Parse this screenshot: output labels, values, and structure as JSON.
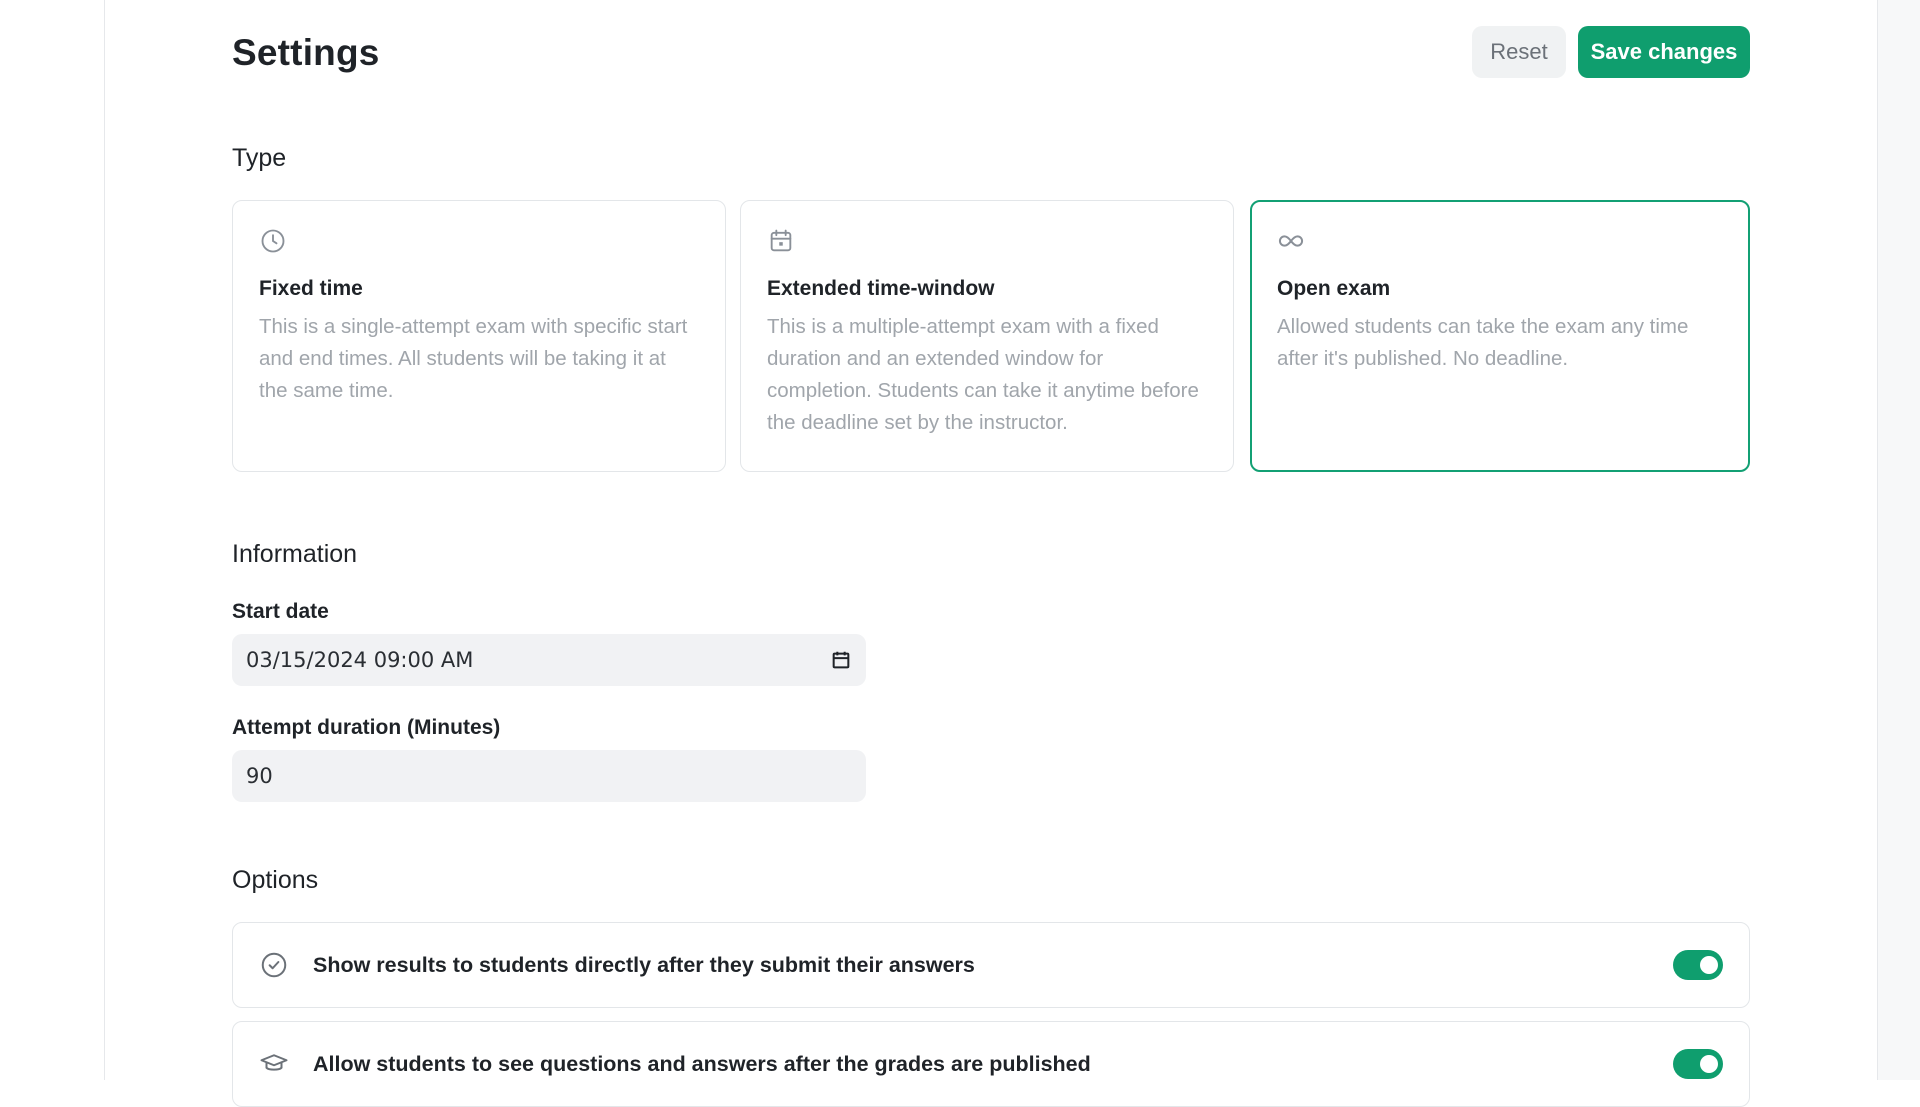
{
  "header": {
    "title": "Settings",
    "reset_label": "Reset",
    "save_label": "Save changes"
  },
  "type_section": {
    "title": "Type",
    "cards": [
      {
        "icon": "clock-icon",
        "title": "Fixed time",
        "description": "This is a single-attempt exam with specific start and end times. All students will be taking it at the same time.",
        "selected": false
      },
      {
        "icon": "calendar-icon",
        "title": "Extended time-window",
        "description": "This is a multiple-attempt exam with a fixed duration and an extended window for completion. Students can take it anytime before the deadline set by the instructor.",
        "selected": false
      },
      {
        "icon": "infinity-icon",
        "title": "Open exam",
        "description": "Allowed students can take the exam any time after it's published. No deadline.",
        "selected": true
      }
    ]
  },
  "information": {
    "title": "Information",
    "start_date_label": "Start date",
    "start_date_value": "03/15/2024 09:00 AM",
    "duration_label": "Attempt duration (Minutes)",
    "duration_value": "90"
  },
  "options": {
    "title": "Options",
    "items": [
      {
        "icon": "check-circle-icon",
        "label": "Show results to students directly after they submit their answers",
        "enabled": true
      },
      {
        "icon": "graduation-cap-icon",
        "label": "Allow students to see questions and answers after the grades are published",
        "enabled": true
      }
    ]
  },
  "colors": {
    "accent": "#0f9e6e",
    "selected_border": "#13a074",
    "muted_text": "#a0a5ab"
  }
}
